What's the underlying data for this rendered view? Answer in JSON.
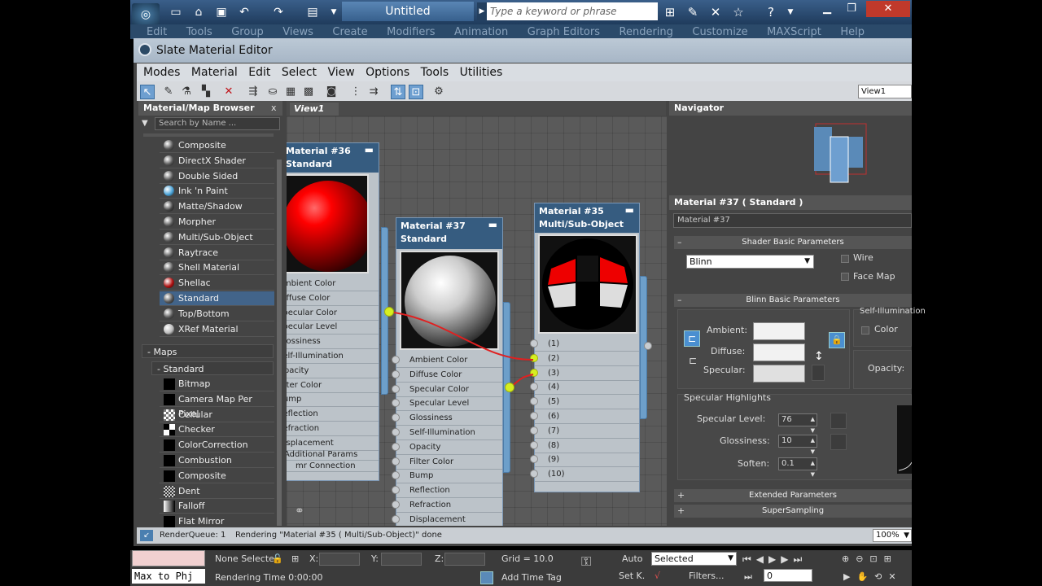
{
  "app": {
    "document_title": "Untitled",
    "search_placeholder": "Type a keyword or phrase",
    "main_menu": [
      "Edit",
      "Tools",
      "Group",
      "Views",
      "Create",
      "Modifiers",
      "Animation",
      "Graph Editors",
      "Rendering",
      "Customize",
      "MAXScript",
      "Help"
    ]
  },
  "slate": {
    "title": "Slate Material Editor",
    "menu": [
      "Modes",
      "Material",
      "Edit",
      "Select",
      "View",
      "Options",
      "Tools",
      "Utilities"
    ],
    "view_select": "View1"
  },
  "browser": {
    "title": "Material/Map Browser",
    "close": "x",
    "search_placeholder": "Search by Name ...",
    "materials": [
      {
        "label": "Composite",
        "color": "#555"
      },
      {
        "label": "DirectX Shader",
        "color": "#555"
      },
      {
        "label": "Double Sided",
        "color": "#555"
      },
      {
        "label": "Ink 'n Paint",
        "color": "#4aa3d8"
      },
      {
        "label": "Matte/Shadow",
        "color": "#444"
      },
      {
        "label": "Morpher",
        "color": "#555"
      },
      {
        "label": "Multi/Sub-Object",
        "color": "#555"
      },
      {
        "label": "Raytrace",
        "color": "#555"
      },
      {
        "label": "Shell Material",
        "color": "#555"
      },
      {
        "label": "Shellac",
        "color": "#b01010"
      },
      {
        "label": "Standard",
        "color": "#555"
      },
      {
        "label": "Top/Bottom",
        "color": "#555"
      },
      {
        "label": "XRef Material",
        "color": "#bbb"
      }
    ],
    "maps_group": "- Maps",
    "standard_group": "- Standard",
    "maps": [
      "Bitmap",
      "Camera Map Per Pixel",
      "Cellular",
      "Checker",
      "ColorCorrection",
      "Combustion",
      "Composite",
      "Dent",
      "Falloff",
      "Flat Mirror"
    ]
  },
  "view": {
    "tab": "View1",
    "node36": {
      "title_line1": "Material #36",
      "title_line2": "Standard",
      "slots": [
        "Ambient Color",
        "Diffuse Color",
        "Specular Color",
        "Specular Level",
        "Glossiness",
        "Self-Illumination",
        "Opacity",
        "Filter Color",
        "Bump",
        "Reflection",
        "Refraction",
        "Displacement"
      ],
      "additional": "Additional Params",
      "connection": "mr Connection"
    },
    "node37": {
      "title_line1": "Material #37",
      "title_line2": "Standard",
      "slots": [
        "Ambient Color",
        "Diffuse Color",
        "Specular Color",
        "Specular Level",
        "Glossiness",
        "Self-Illumination",
        "Opacity",
        "Filter Color",
        "Bump",
        "Reflection",
        "Refraction",
        "Displacement"
      ]
    },
    "node35": {
      "title_line1": "Material #35",
      "title_line2": "Multi/Sub-Object",
      "slots": [
        "(1)",
        "(2)",
        "(3)",
        "(4)",
        "(5)",
        "(6)",
        "(7)",
        "(8)",
        "(9)",
        "(10)"
      ]
    }
  },
  "navigator": {
    "title": "Navigator"
  },
  "props": {
    "header": "Material #37  ( Standard )",
    "name": "Material #37",
    "shader": {
      "rollout": "Shader Basic Parameters",
      "shader": "Blinn",
      "wire": "Wire",
      "facemap": "Face Map"
    },
    "blinn": {
      "rollout": "Blinn Basic Parameters",
      "self_illum_title": "Self-Illumination",
      "color_label": "Color",
      "ambient": "Ambient:",
      "diffuse": "Diffuse:",
      "specular": "Specular:",
      "opacity": "Opacity:"
    },
    "highlights": {
      "title": "Specular Highlights",
      "level_label": "Specular Level:",
      "level": "76",
      "gloss_label": "Glossiness:",
      "gloss": "10",
      "soften_label": "Soften:",
      "soften": "0.1"
    },
    "extended": "Extended Parameters",
    "supersampling": "SuperSampling"
  },
  "status": {
    "queue": "RenderQueue: 1",
    "message": "Rendering \"Material #35 ( Multi/Sub-Object)\" done",
    "zoom": "100%"
  },
  "bottom": {
    "maxscript": "Max to Phj",
    "none_selected": "None Selecte",
    "x_label": "X:",
    "y_label": "Y:",
    "z_label": "Z:",
    "grid": "Grid = 10.0",
    "auto": "Auto",
    "selected": "Selected",
    "rendering_time": "Rendering Time  0:00:00",
    "add_time_tag": "Add Time Tag",
    "set_key": "Set K.",
    "filters": "Filters...",
    "frame": "0"
  }
}
